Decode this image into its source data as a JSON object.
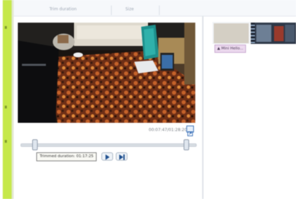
{
  "header": {
    "tabs": [
      {
        "label": "Trim duration"
      },
      {
        "label": "Size"
      }
    ]
  },
  "preview": {
    "timestamp": "00:07:47/01:28:20",
    "fullscreen_icon": "fullscreen-icon"
  },
  "trim": {
    "tooltip": "Trimmed duration: 01:17:25"
  },
  "controls": {
    "play_icon": "play-icon",
    "next_frame_icon": "next-frame-icon"
  },
  "timeline": {
    "clip_label": "▲ Mini Hello..."
  },
  "colors": {
    "accent_rail": "#c6e84b",
    "selection": "#3a70b8"
  }
}
